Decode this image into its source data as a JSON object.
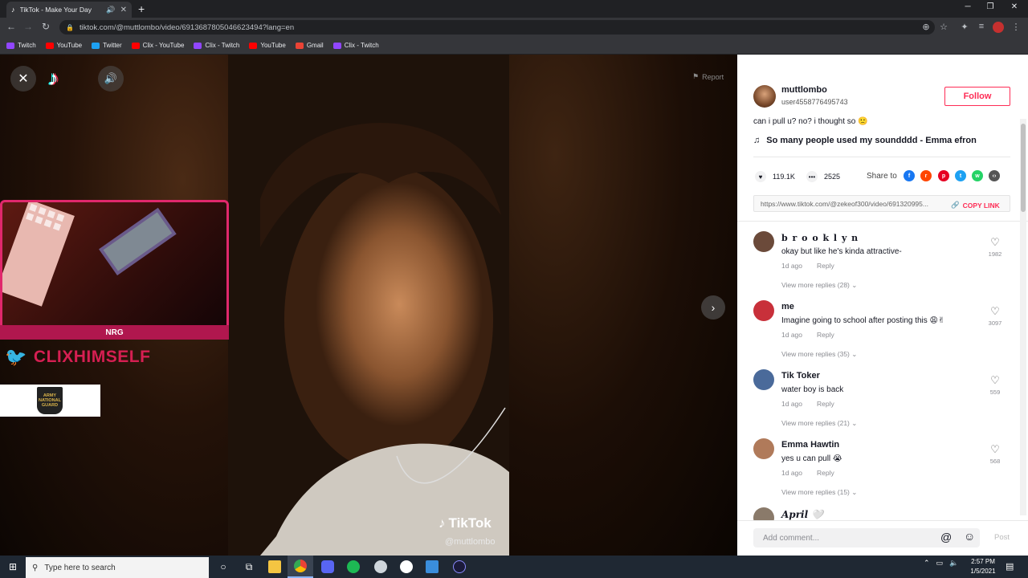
{
  "browser": {
    "tab_title": "TikTok - Make Your Day",
    "url": "tiktok.com/@muttlombo/video/6913687805046623494?lang=en",
    "bookmarks": [
      {
        "label": "Twitch",
        "color": "#9146ff"
      },
      {
        "label": "YouTube",
        "color": "#ff0000"
      },
      {
        "label": "Twitter",
        "color": "#1da1f2"
      },
      {
        "label": "Clix - YouTube",
        "color": "#ff0000"
      },
      {
        "label": "Clix - Twitch",
        "color": "#9146ff"
      },
      {
        "label": "YouTube",
        "color": "#ff0000"
      },
      {
        "label": "Gmail",
        "color": "#ea4335"
      },
      {
        "label": "Clix - Twitch",
        "color": "#9146ff"
      }
    ]
  },
  "video": {
    "report_label": "Report",
    "watermark_brand": "TikTok",
    "watermark_user": "@muttlombo",
    "stream_overlay": {
      "badge": "NRG",
      "twitter_handle": "CLIXHIMSELF",
      "sponsor": "ARMY NATIONAL GUARD"
    }
  },
  "post": {
    "author_name": "muttlombo",
    "author_id": "user4558776495743",
    "follow_label": "Follow",
    "caption": "can i pull u? no? i thought so 🙁",
    "music": "So many people used my soundddd - Emma efron",
    "likes": "119.1K",
    "comments": "2525",
    "share_label": "Share to",
    "share_link": "https://www.tiktok.com/@zekeof300/video/691320995...",
    "copy_link_label": "COPY LINK"
  },
  "comments": [
    {
      "name": "b r o o k l y n",
      "text": "okay but like he's kinda attractive-",
      "age": "1d ago",
      "reply": "Reply",
      "view_more": "View more replies (28)",
      "likes": "1982",
      "avatar_color": "#6b4a3a"
    },
    {
      "name": "me",
      "text": "Imagine going to school after posting this 😩✌",
      "age": "1d ago",
      "reply": "Reply",
      "view_more": "View more replies (35)",
      "likes": "3097",
      "avatar_color": "#c8303a"
    },
    {
      "name": "Tik Toker",
      "text": "water boy is back",
      "age": "1d ago",
      "reply": "Reply",
      "view_more": "View more replies (21)",
      "likes": "559",
      "avatar_color": "#4a6a9a"
    },
    {
      "name": "Emma Hawtin",
      "text": "yes u can pull 😭",
      "age": "1d ago",
      "reply": "Reply",
      "view_more": "View more replies (15)",
      "likes": "568",
      "avatar_color": "#b07a5a"
    },
    {
      "name": "April 🤍",
      "text": "",
      "age": "",
      "reply": "",
      "view_more": "",
      "likes": "",
      "avatar_color": "#8a7a6a"
    }
  ],
  "comment_box": {
    "placeholder": "Add comment...",
    "post_label": "Post"
  },
  "taskbar": {
    "search_placeholder": "Type here to search",
    "time": "2:57 PM",
    "date": "1/5/2021"
  }
}
